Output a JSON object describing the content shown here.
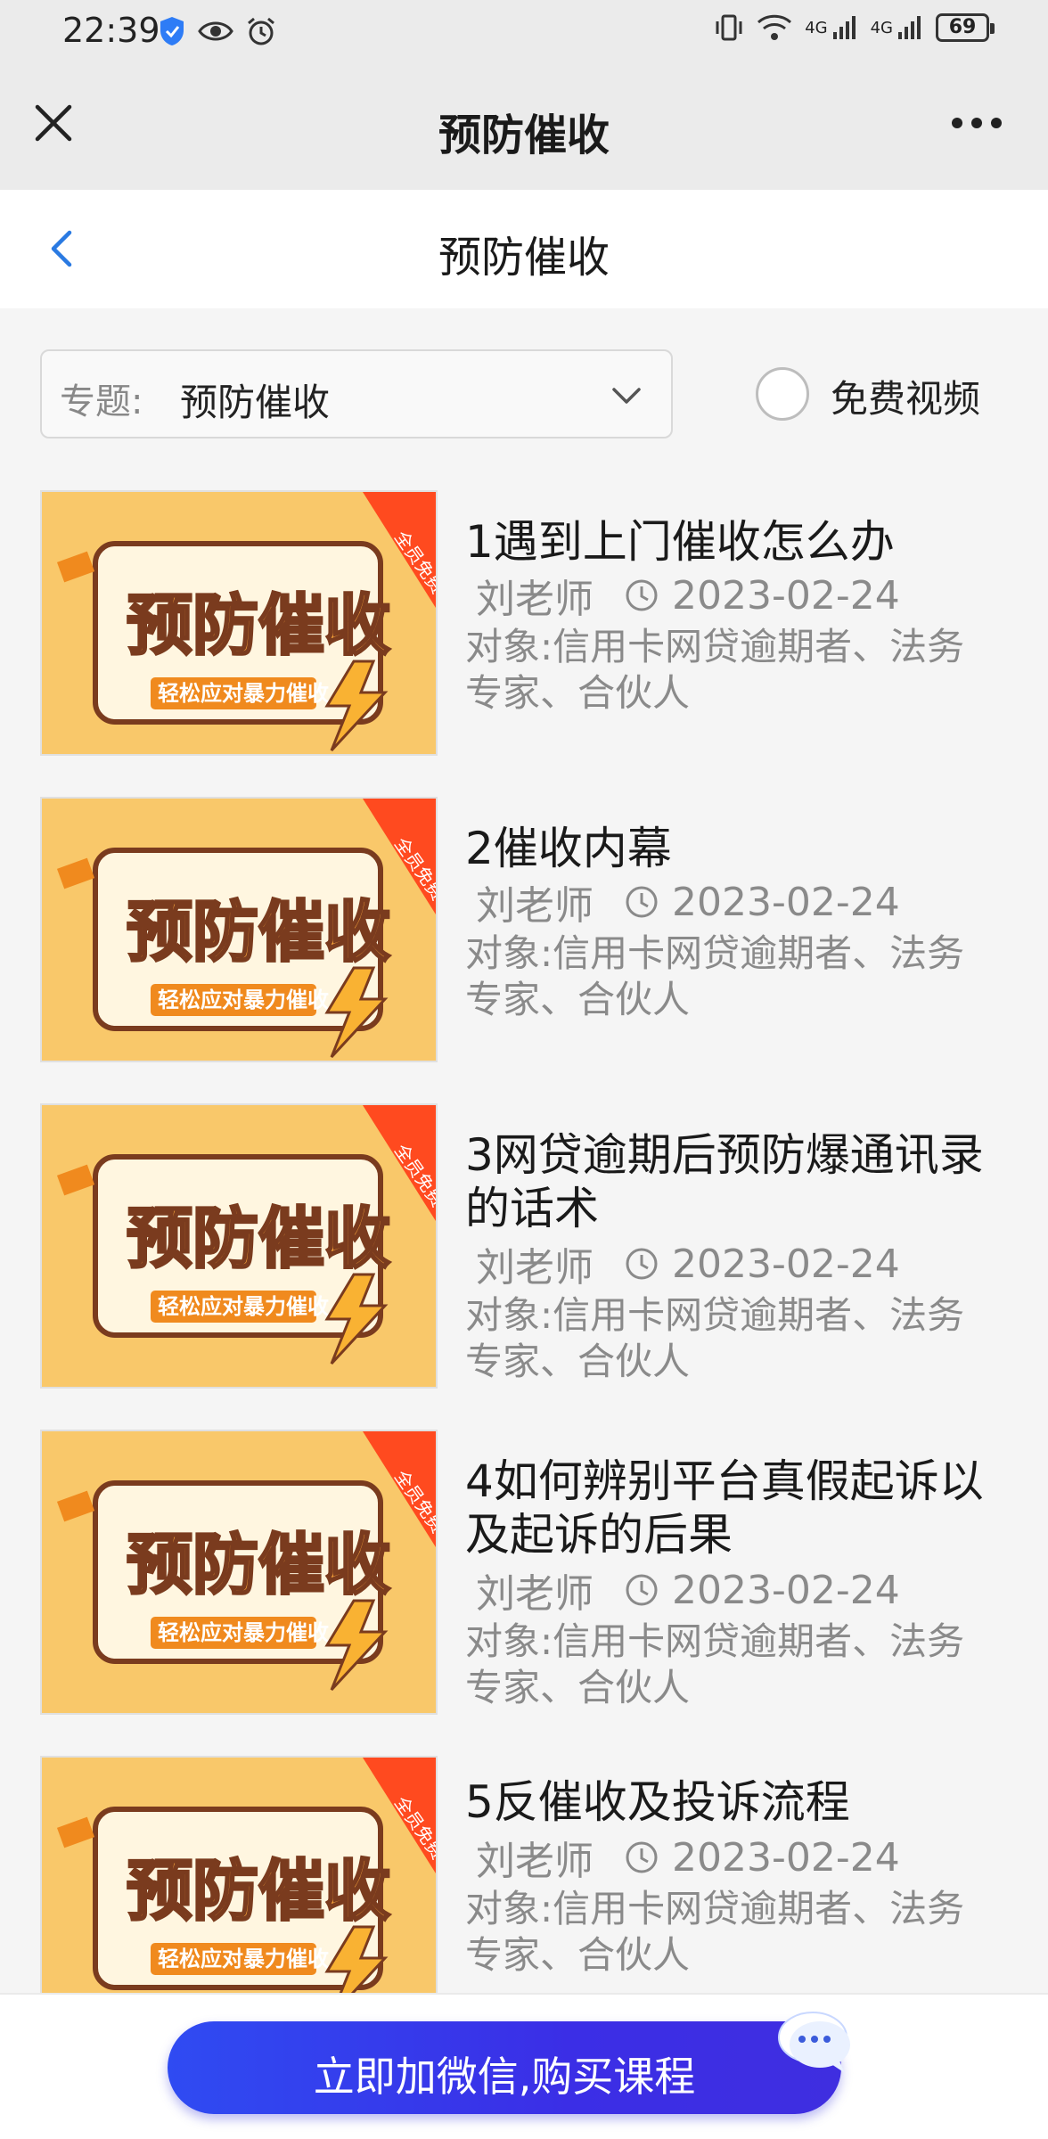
{
  "status_bar": {
    "time": "22:39",
    "network_label": "4G",
    "network_label_2": "4G",
    "battery": "69"
  },
  "app_bar": {
    "title": "预防催收"
  },
  "page_bar": {
    "title": "预防催收"
  },
  "filter": {
    "topic_label": "专题:",
    "topic_value": "预防催收",
    "free_video_label": "免费视频",
    "free_video_checked": false
  },
  "thumbnail": {
    "main_text": "预防催收",
    "sub_text": "轻松应对暴力催收",
    "ribbon_text": "全员免费"
  },
  "courses": [
    {
      "title": "1遇到上门催收怎么办",
      "teacher": "刘老师",
      "date": "2023-02-24",
      "audience": "对象:信用卡网贷逾期者、法务专家、合伙人"
    },
    {
      "title": "2催收内幕",
      "teacher": "刘老师",
      "date": "2023-02-24",
      "audience": "对象:信用卡网贷逾期者、法务专家、合伙人"
    },
    {
      "title": "3网贷逾期后预防爆通讯录的话术",
      "teacher": "刘老师",
      "date": "2023-02-24",
      "audience": "对象:信用卡网贷逾期者、法务专家、合伙人"
    },
    {
      "title": "4如何辨别平台真假起诉以及起诉的后果",
      "teacher": "刘老师",
      "date": "2023-02-24",
      "audience": "对象:信用卡网贷逾期者、法务专家、合伙人"
    },
    {
      "title": "5反催收及投诉流程",
      "teacher": "刘老师",
      "date": "2023-02-24",
      "audience": "对象:信用卡网贷逾期者、法务专家、合伙人"
    }
  ],
  "bottom": {
    "buy_label": "立即加微信,购买课程"
  },
  "colors": {
    "accent_blue": "#3b35e8",
    "thumb_yellow": "#f9c86a",
    "thumb_brown": "#7a3b1e",
    "ribbon_red": "#ff4a1f",
    "back_arrow": "#2a7ae2"
  }
}
